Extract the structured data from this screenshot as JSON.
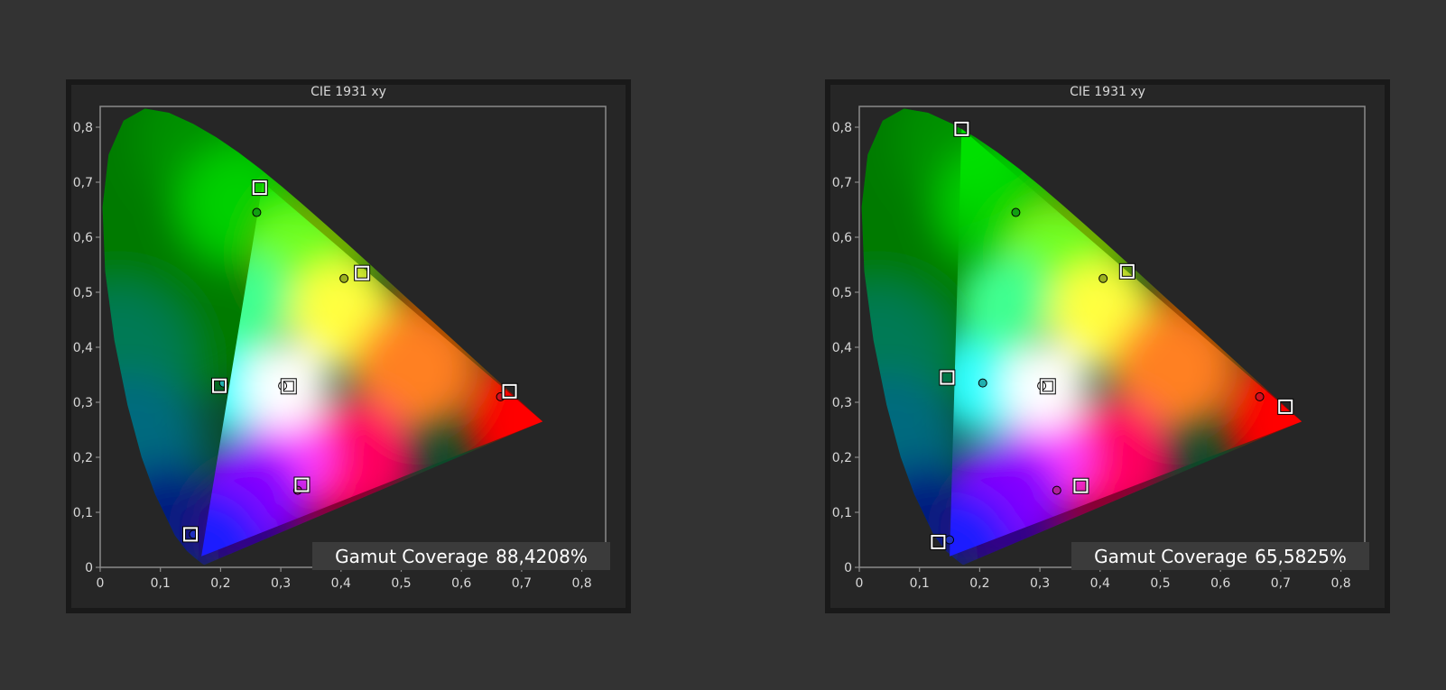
{
  "chart_data": [
    {
      "type": "scatter",
      "title": "CIE 1931 xy",
      "xlim": [
        0,
        0.85
      ],
      "ylim": [
        0,
        0.85
      ],
      "x_ticks": [
        0,
        0.1,
        0.2,
        0.3,
        0.4,
        0.5,
        0.6,
        0.7,
        0.8
      ],
      "y_ticks": [
        0,
        0.1,
        0.2,
        0.3,
        0.4,
        0.5,
        0.6,
        0.7,
        0.8
      ],
      "x_tick_labels": [
        "0",
        "0,1",
        "0,2",
        "0,3",
        "0,4",
        "0,5",
        "0,6",
        "0,7",
        "0,8"
      ],
      "y_tick_labels": [
        "0",
        "0,1",
        "0,2",
        "0,3",
        "0,4",
        "0,5",
        "0,6",
        "0,7",
        "0,8"
      ],
      "gamut_label": "Gamut Coverage",
      "gamut_value": "88,4208%",
      "targets": [
        {
          "x": 0.265,
          "y": 0.69
        },
        {
          "x": 0.435,
          "y": 0.535
        },
        {
          "x": 0.68,
          "y": 0.32
        },
        {
          "x": 0.335,
          "y": 0.15
        },
        {
          "x": 0.15,
          "y": 0.06
        },
        {
          "x": 0.198,
          "y": 0.33
        },
        {
          "x": 0.313,
          "y": 0.329
        }
      ],
      "measured": [
        {
          "x": 0.26,
          "y": 0.645,
          "color": "#11a011"
        },
        {
          "x": 0.405,
          "y": 0.525,
          "color": "#9bb021"
        },
        {
          "x": 0.665,
          "y": 0.31,
          "color": "#d01020"
        },
        {
          "x": 0.328,
          "y": 0.14,
          "color": "#b0209a"
        },
        {
          "x": 0.155,
          "y": 0.06,
          "color": "#2030c0"
        },
        {
          "x": 0.205,
          "y": 0.335,
          "color": "#20b0b0"
        },
        {
          "x": 0.303,
          "y": 0.33,
          "color": "#ffffff"
        }
      ],
      "gamut_triangle": [
        [
          0.27,
          0.7
        ],
        [
          0.735,
          0.265
        ],
        [
          0.168,
          0.02
        ]
      ]
    },
    {
      "type": "scatter",
      "title": "CIE 1931 xy",
      "xlim": [
        0,
        0.85
      ],
      "ylim": [
        0,
        0.85
      ],
      "x_ticks": [
        0,
        0.1,
        0.2,
        0.3,
        0.4,
        0.5,
        0.6,
        0.7,
        0.8
      ],
      "y_ticks": [
        0,
        0.1,
        0.2,
        0.3,
        0.4,
        0.5,
        0.6,
        0.7,
        0.8
      ],
      "x_tick_labels": [
        "0",
        "0,1",
        "0,2",
        "0,3",
        "0,4",
        "0,5",
        "0,6",
        "0,7",
        "0,8"
      ],
      "y_tick_labels": [
        "0",
        "0,1",
        "0,2",
        "0,3",
        "0,4",
        "0,5",
        "0,6",
        "0,7",
        "0,8"
      ],
      "gamut_label": "Gamut Coverage",
      "gamut_value": "65,5825%",
      "targets": [
        {
          "x": 0.17,
          "y": 0.797
        },
        {
          "x": 0.445,
          "y": 0.538
        },
        {
          "x": 0.708,
          "y": 0.292
        },
        {
          "x": 0.368,
          "y": 0.148
        },
        {
          "x": 0.131,
          "y": 0.046
        },
        {
          "x": 0.146,
          "y": 0.345
        },
        {
          "x": 0.313,
          "y": 0.329
        }
      ],
      "measured": [
        {
          "x": 0.26,
          "y": 0.645,
          "color": "#11a011"
        },
        {
          "x": 0.405,
          "y": 0.525,
          "color": "#9bb021"
        },
        {
          "x": 0.665,
          "y": 0.31,
          "color": "#d01020"
        },
        {
          "x": 0.328,
          "y": 0.14,
          "color": "#b0209a"
        },
        {
          "x": 0.15,
          "y": 0.05,
          "color": "#2030c0"
        },
        {
          "x": 0.205,
          "y": 0.335,
          "color": "#20b0b0"
        },
        {
          "x": 0.303,
          "y": 0.33,
          "color": "#ffffff"
        }
      ],
      "gamut_triangle": [
        [
          0.17,
          0.797
        ],
        [
          0.735,
          0.265
        ],
        [
          0.15,
          0.02
        ]
      ]
    }
  ]
}
